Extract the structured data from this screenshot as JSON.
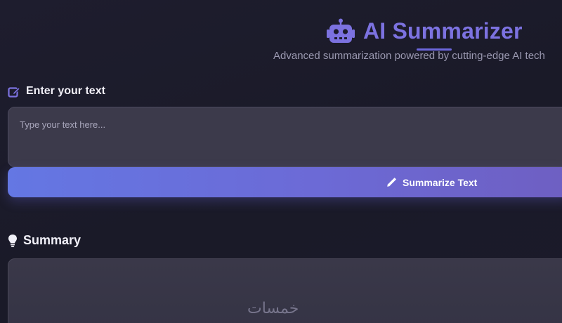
{
  "header": {
    "title": "AI Summarizer",
    "subtitle": "Advanced summarization powered by cutting-edge AI tech",
    "icon": "robot-icon",
    "accent_color": "#7c72e0"
  },
  "input_section": {
    "label": "Enter your text",
    "icon": "edit-icon",
    "placeholder": "Type your text here...",
    "value": ""
  },
  "summarize_button": {
    "label": "Summarize Text",
    "icon": "pencil-icon",
    "gradient_start": "#6477e3",
    "gradient_end": "#6e5fc2"
  },
  "summary_section": {
    "label": "Summary",
    "icon": "lightbulb-icon",
    "content": ""
  },
  "watermark": "خمسات"
}
